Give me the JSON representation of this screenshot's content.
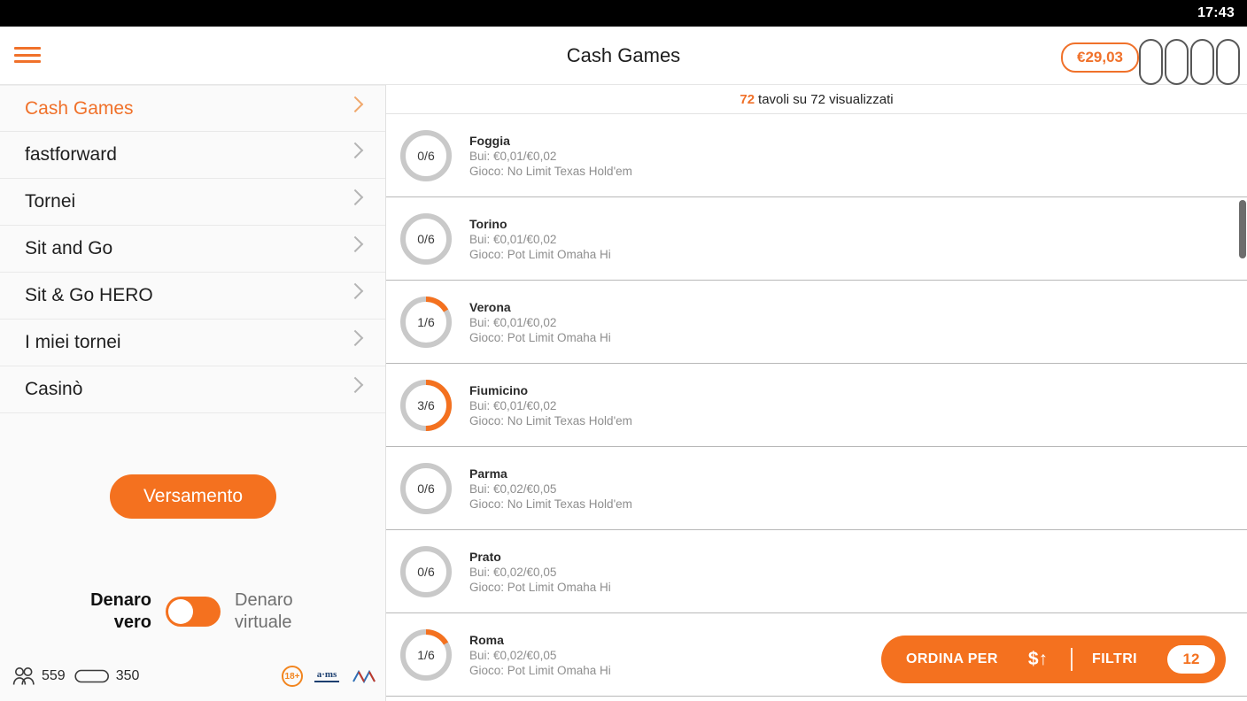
{
  "statusbar": {
    "time": "17:43"
  },
  "header": {
    "title": "Cash Games",
    "balance": "€29,03",
    "menu_icon": "hamburger-menu-icon",
    "table_slots": 4
  },
  "sidebar": {
    "items": [
      {
        "label": "Cash Games",
        "active": true
      },
      {
        "label": "fastforward",
        "active": false
      },
      {
        "label": "Tornei",
        "active": false
      },
      {
        "label": "Sit and Go",
        "active": false
      },
      {
        "label": "Sit & Go HERO",
        "active": false
      },
      {
        "label": "I miei tornei",
        "active": false
      },
      {
        "label": "Casinò",
        "active": false
      }
    ],
    "deposit_label": "Versamento",
    "money_toggle": {
      "left_label_line1": "Denaro",
      "left_label_line2": "vero",
      "right_label_line1": "Denaro",
      "right_label_line2": "virtuale",
      "state": "real"
    },
    "footer": {
      "players_count": "559",
      "tables_count": "350",
      "age_badge": "18+",
      "adm_label": "a·ms"
    }
  },
  "list": {
    "header_count": "72",
    "header_text": "tavoli su 72 visualizzati",
    "rows": [
      {
        "seats": "0/6",
        "filled": 0,
        "total": 6,
        "name": "Foggia",
        "blinds": "Bui: €0,01/€0,02",
        "game": "Gioco: No Limit Texas Hold'em"
      },
      {
        "seats": "0/6",
        "filled": 0,
        "total": 6,
        "name": "Torino",
        "blinds": "Bui: €0,01/€0,02",
        "game": "Gioco: Pot Limit Omaha Hi"
      },
      {
        "seats": "1/6",
        "filled": 1,
        "total": 6,
        "name": "Verona",
        "blinds": "Bui: €0,01/€0,02",
        "game": "Gioco: Pot Limit Omaha Hi"
      },
      {
        "seats": "3/6",
        "filled": 3,
        "total": 6,
        "name": "Fiumicino",
        "blinds": "Bui: €0,01/€0,02",
        "game": "Gioco: No Limit Texas Hold'em"
      },
      {
        "seats": "0/6",
        "filled": 0,
        "total": 6,
        "name": "Parma",
        "blinds": "Bui: €0,02/€0,05",
        "game": "Gioco: No Limit Texas Hold'em"
      },
      {
        "seats": "0/6",
        "filled": 0,
        "total": 6,
        "name": "Prato",
        "blinds": "Bui: €0,02/€0,05",
        "game": "Gioco: Pot Limit Omaha Hi"
      },
      {
        "seats": "1/6",
        "filled": 1,
        "total": 6,
        "name": "Roma",
        "blinds": "Bui: €0,02/€0,05",
        "game": "Gioco: Pot Limit Omaha Hi"
      }
    ]
  },
  "actionbar": {
    "sort_label": "ORDINA PER",
    "sort_icon": "$↑",
    "filter_label": "FILTRI",
    "filter_count": "12"
  },
  "colors": {
    "accent": "#f4711f",
    "accent_text": "#f0712a",
    "ring_track": "#c9c9c9",
    "ring_fill": "#f4711f"
  }
}
